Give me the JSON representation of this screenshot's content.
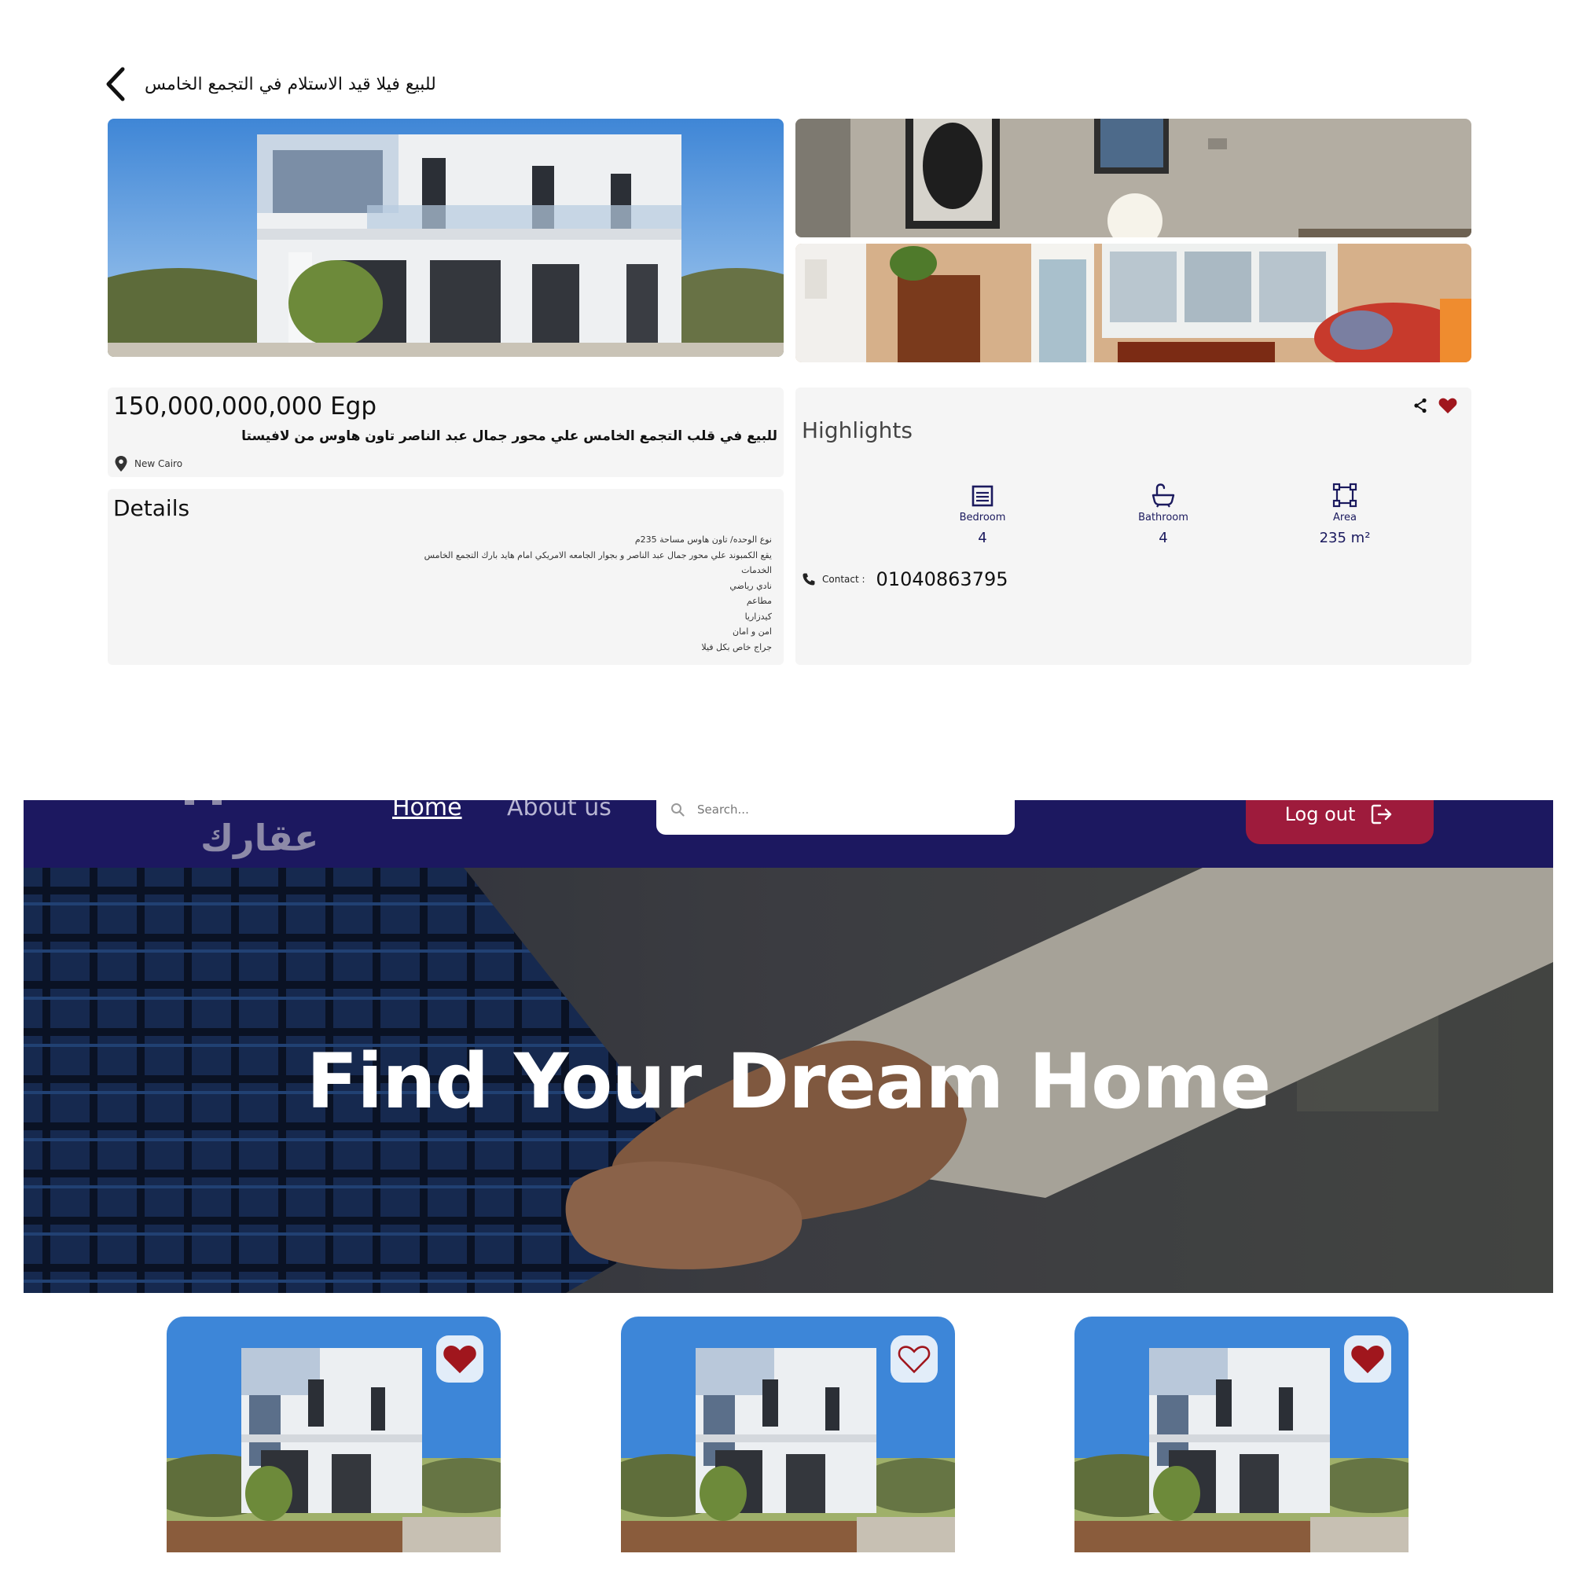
{
  "detail": {
    "back_title": "للبيع فيلا قيد الاستلام في التجمع الخامس",
    "price": "150,000,000,000 Egp",
    "listing_title": "للبيع في قلب التجمع الخامس علي محور جمال عبد الناصر تاون هاوس من لافيستا",
    "location": "New Cairo",
    "details_heading": "Details",
    "details_lines": [
      "نوع الوحده/ تاون هاوس مساحة 235م",
      "يقع الكمبوند علي محور جمال عبد الناصر و بجوار الجامعه الامريكي امام هايد بارك التجمع الخامس",
      "الخدمات",
      "نادي رياضي",
      "مطاعم",
      "كيدزاريا",
      "امن و امان",
      "جراج خاص بكل فيلا"
    ],
    "highlights_heading": "Highlights",
    "features": {
      "bedroom": {
        "label": "Bedroom",
        "value": "4",
        "icon": "bed-icon"
      },
      "bathroom": {
        "label": "Bathroom",
        "value": "4",
        "icon": "bathtub-icon"
      },
      "area": {
        "label": "Area",
        "value": "235 m²",
        "icon": "area-icon"
      }
    },
    "contact_label": "Contact :",
    "contact_number": "01040863795",
    "favorited": true
  },
  "home": {
    "logo_text": "عقارك",
    "nav": {
      "home": "Home",
      "about": "About us"
    },
    "search_placeholder": "Search...",
    "logout_label": "Log out",
    "hero_title": "Find Your Dream Home",
    "cards": [
      {
        "favorited": true
      },
      {
        "favorited": false
      },
      {
        "favorited": true
      }
    ]
  },
  "colors": {
    "nav_bg": "#1c1860",
    "logout_bg": "#9e1b3c",
    "heart": "#a0161d",
    "feature_text": "#1b1a5e",
    "card_bg": "#f5f5f5"
  }
}
